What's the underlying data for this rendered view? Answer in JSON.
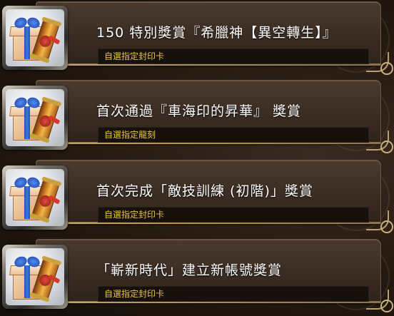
{
  "rewards": [
    {
      "title": "150 特別獎賞『希臘神【異空轉生】』",
      "subtitle": "自選指定封印卡",
      "icon": "gift-box-scroll-icon"
    },
    {
      "title": "首次通過『車海印的昇華』 獎賞",
      "subtitle": "自選指定龍刻",
      "icon": "gift-box-scroll-icon"
    },
    {
      "title": "首次完成「敵技訓練 (初階)」獎賞",
      "subtitle": "自選指定封印卡",
      "icon": "gift-box-scroll-icon"
    },
    {
      "title": "「嶄新時代」建立新帳號獎賞",
      "subtitle": "自選指定封印卡",
      "icon": "gift-box-scroll-icon"
    }
  ],
  "colors": {
    "title": "#ffffff",
    "subtitle": "#e8c14a",
    "panel": "#3b2d23",
    "accent_gold": "#b8a070"
  }
}
